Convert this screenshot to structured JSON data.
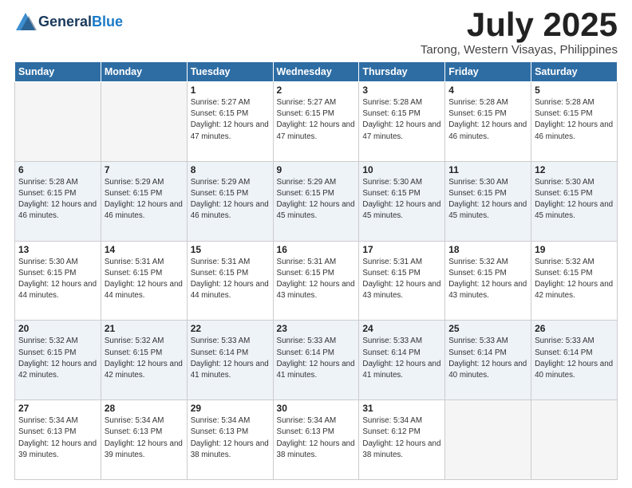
{
  "header": {
    "logo_line1": "General",
    "logo_line2": "Blue",
    "month": "July 2025",
    "location": "Tarong, Western Visayas, Philippines"
  },
  "days_of_week": [
    "Sunday",
    "Monday",
    "Tuesday",
    "Wednesday",
    "Thursday",
    "Friday",
    "Saturday"
  ],
  "weeks": [
    [
      {
        "day": "",
        "sunrise": "",
        "sunset": "",
        "daylight": ""
      },
      {
        "day": "",
        "sunrise": "",
        "sunset": "",
        "daylight": ""
      },
      {
        "day": "1",
        "sunrise": "Sunrise: 5:27 AM",
        "sunset": "Sunset: 6:15 PM",
        "daylight": "Daylight: 12 hours and 47 minutes."
      },
      {
        "day": "2",
        "sunrise": "Sunrise: 5:27 AM",
        "sunset": "Sunset: 6:15 PM",
        "daylight": "Daylight: 12 hours and 47 minutes."
      },
      {
        "day": "3",
        "sunrise": "Sunrise: 5:28 AM",
        "sunset": "Sunset: 6:15 PM",
        "daylight": "Daylight: 12 hours and 47 minutes."
      },
      {
        "day": "4",
        "sunrise": "Sunrise: 5:28 AM",
        "sunset": "Sunset: 6:15 PM",
        "daylight": "Daylight: 12 hours and 46 minutes."
      },
      {
        "day": "5",
        "sunrise": "Sunrise: 5:28 AM",
        "sunset": "Sunset: 6:15 PM",
        "daylight": "Daylight: 12 hours and 46 minutes."
      }
    ],
    [
      {
        "day": "6",
        "sunrise": "Sunrise: 5:28 AM",
        "sunset": "Sunset: 6:15 PM",
        "daylight": "Daylight: 12 hours and 46 minutes."
      },
      {
        "day": "7",
        "sunrise": "Sunrise: 5:29 AM",
        "sunset": "Sunset: 6:15 PM",
        "daylight": "Daylight: 12 hours and 46 minutes."
      },
      {
        "day": "8",
        "sunrise": "Sunrise: 5:29 AM",
        "sunset": "Sunset: 6:15 PM",
        "daylight": "Daylight: 12 hours and 46 minutes."
      },
      {
        "day": "9",
        "sunrise": "Sunrise: 5:29 AM",
        "sunset": "Sunset: 6:15 PM",
        "daylight": "Daylight: 12 hours and 45 minutes."
      },
      {
        "day": "10",
        "sunrise": "Sunrise: 5:30 AM",
        "sunset": "Sunset: 6:15 PM",
        "daylight": "Daylight: 12 hours and 45 minutes."
      },
      {
        "day": "11",
        "sunrise": "Sunrise: 5:30 AM",
        "sunset": "Sunset: 6:15 PM",
        "daylight": "Daylight: 12 hours and 45 minutes."
      },
      {
        "day": "12",
        "sunrise": "Sunrise: 5:30 AM",
        "sunset": "Sunset: 6:15 PM",
        "daylight": "Daylight: 12 hours and 45 minutes."
      }
    ],
    [
      {
        "day": "13",
        "sunrise": "Sunrise: 5:30 AM",
        "sunset": "Sunset: 6:15 PM",
        "daylight": "Daylight: 12 hours and 44 minutes."
      },
      {
        "day": "14",
        "sunrise": "Sunrise: 5:31 AM",
        "sunset": "Sunset: 6:15 PM",
        "daylight": "Daylight: 12 hours and 44 minutes."
      },
      {
        "day": "15",
        "sunrise": "Sunrise: 5:31 AM",
        "sunset": "Sunset: 6:15 PM",
        "daylight": "Daylight: 12 hours and 44 minutes."
      },
      {
        "day": "16",
        "sunrise": "Sunrise: 5:31 AM",
        "sunset": "Sunset: 6:15 PM",
        "daylight": "Daylight: 12 hours and 43 minutes."
      },
      {
        "day": "17",
        "sunrise": "Sunrise: 5:31 AM",
        "sunset": "Sunset: 6:15 PM",
        "daylight": "Daylight: 12 hours and 43 minutes."
      },
      {
        "day": "18",
        "sunrise": "Sunrise: 5:32 AM",
        "sunset": "Sunset: 6:15 PM",
        "daylight": "Daylight: 12 hours and 43 minutes."
      },
      {
        "day": "19",
        "sunrise": "Sunrise: 5:32 AM",
        "sunset": "Sunset: 6:15 PM",
        "daylight": "Daylight: 12 hours and 42 minutes."
      }
    ],
    [
      {
        "day": "20",
        "sunrise": "Sunrise: 5:32 AM",
        "sunset": "Sunset: 6:15 PM",
        "daylight": "Daylight: 12 hours and 42 minutes."
      },
      {
        "day": "21",
        "sunrise": "Sunrise: 5:32 AM",
        "sunset": "Sunset: 6:15 PM",
        "daylight": "Daylight: 12 hours and 42 minutes."
      },
      {
        "day": "22",
        "sunrise": "Sunrise: 5:33 AM",
        "sunset": "Sunset: 6:14 PM",
        "daylight": "Daylight: 12 hours and 41 minutes."
      },
      {
        "day": "23",
        "sunrise": "Sunrise: 5:33 AM",
        "sunset": "Sunset: 6:14 PM",
        "daylight": "Daylight: 12 hours and 41 minutes."
      },
      {
        "day": "24",
        "sunrise": "Sunrise: 5:33 AM",
        "sunset": "Sunset: 6:14 PM",
        "daylight": "Daylight: 12 hours and 41 minutes."
      },
      {
        "day": "25",
        "sunrise": "Sunrise: 5:33 AM",
        "sunset": "Sunset: 6:14 PM",
        "daylight": "Daylight: 12 hours and 40 minutes."
      },
      {
        "day": "26",
        "sunrise": "Sunrise: 5:33 AM",
        "sunset": "Sunset: 6:14 PM",
        "daylight": "Daylight: 12 hours and 40 minutes."
      }
    ],
    [
      {
        "day": "27",
        "sunrise": "Sunrise: 5:34 AM",
        "sunset": "Sunset: 6:13 PM",
        "daylight": "Daylight: 12 hours and 39 minutes."
      },
      {
        "day": "28",
        "sunrise": "Sunrise: 5:34 AM",
        "sunset": "Sunset: 6:13 PM",
        "daylight": "Daylight: 12 hours and 39 minutes."
      },
      {
        "day": "29",
        "sunrise": "Sunrise: 5:34 AM",
        "sunset": "Sunset: 6:13 PM",
        "daylight": "Daylight: 12 hours and 38 minutes."
      },
      {
        "day": "30",
        "sunrise": "Sunrise: 5:34 AM",
        "sunset": "Sunset: 6:13 PM",
        "daylight": "Daylight: 12 hours and 38 minutes."
      },
      {
        "day": "31",
        "sunrise": "Sunrise: 5:34 AM",
        "sunset": "Sunset: 6:12 PM",
        "daylight": "Daylight: 12 hours and 38 minutes."
      },
      {
        "day": "",
        "sunrise": "",
        "sunset": "",
        "daylight": ""
      },
      {
        "day": "",
        "sunrise": "",
        "sunset": "",
        "daylight": ""
      }
    ]
  ]
}
